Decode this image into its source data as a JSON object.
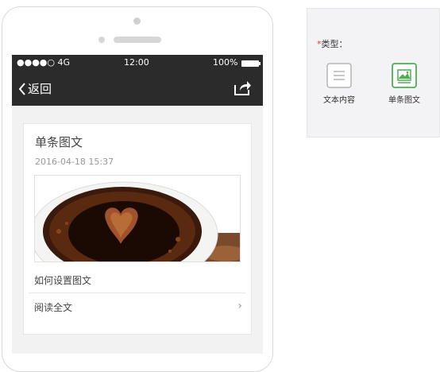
{
  "phone": {
    "status": {
      "signal": "●●●●○ 4G",
      "time": "12:00",
      "battery": "100%"
    },
    "nav": {
      "back_label": "返回"
    },
    "card": {
      "title": "单条图文",
      "date": "2016-04-18 15:37",
      "description": "如何设置图文",
      "read_more": "阅读全文"
    }
  },
  "panel": {
    "required_mark": "*",
    "type_label": "类型：",
    "options": [
      {
        "label": "文本内容",
        "icon": "text-content-icon",
        "selected": false
      },
      {
        "label": "单条图文",
        "icon": "single-image-text-icon",
        "selected": true
      }
    ],
    "accent_color": "#4caf50"
  }
}
